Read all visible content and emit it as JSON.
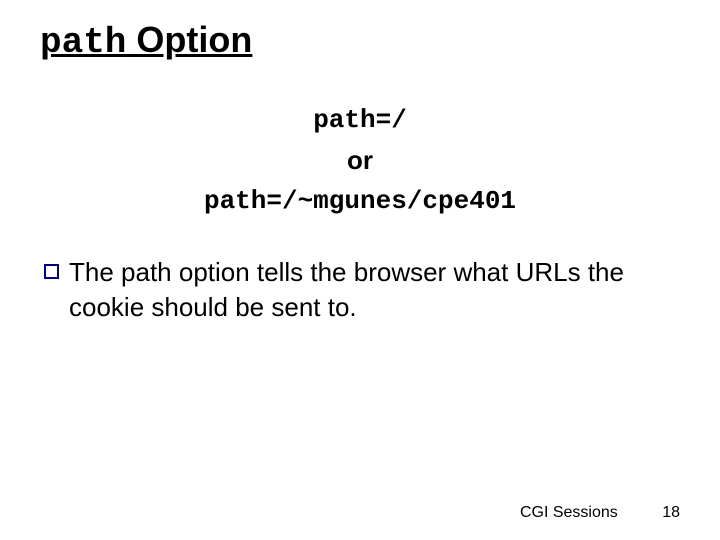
{
  "title": {
    "code": "path",
    "rest": " Option"
  },
  "code": {
    "line1": "path=/",
    "or": "or",
    "line2": "path=/~mgunes/cpe401"
  },
  "bullet": {
    "text": "The path option tells the browser what URLs the cookie should be sent to."
  },
  "footer": {
    "label": "CGI Sessions",
    "page": "18"
  }
}
